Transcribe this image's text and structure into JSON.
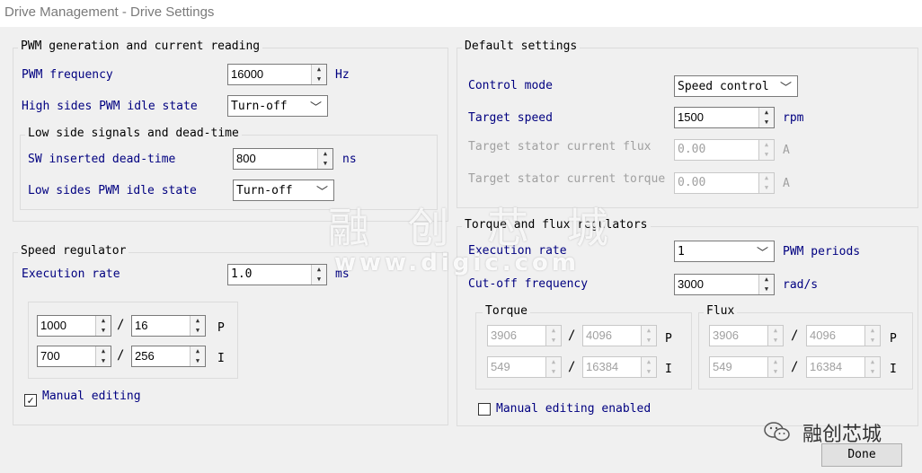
{
  "window": {
    "title": "Drive Management - Drive Settings"
  },
  "pwm_group": {
    "title": "PWM generation and current reading",
    "pwm_frequency": {
      "label": "PWM frequency",
      "value": "16000",
      "unit": "Hz"
    },
    "high_idle": {
      "label": "High sides PWM idle state",
      "value": "Turn-off"
    },
    "low_side": {
      "title": "Low side signals and dead-time",
      "dead_time": {
        "label": "SW inserted dead-time",
        "value": "800",
        "unit": "ns"
      },
      "low_idle": {
        "label": "Low sides PWM idle state",
        "value": "Turn-off"
      }
    }
  },
  "speed_group": {
    "title": "Speed regulator",
    "execution_rate": {
      "label": "Execution rate",
      "value": "1.0",
      "unit": "ms"
    },
    "p": {
      "num": "1000",
      "den": "16",
      "label": "P"
    },
    "i": {
      "num": "700",
      "den": "256",
      "label": "I"
    },
    "slash": "/",
    "manual_editing": {
      "label": "Manual editing",
      "checked": true
    }
  },
  "default_group": {
    "title": "Default settings",
    "control_mode": {
      "label": "Control mode",
      "value": "Speed control"
    },
    "target_speed": {
      "label": "Target speed",
      "value": "1500",
      "unit": "rpm"
    },
    "target_flux": {
      "label": "Target stator current flux",
      "value": "0.00",
      "unit": "A"
    },
    "target_torque": {
      "label": "Target stator current torque",
      "value": "0.00",
      "unit": "A"
    }
  },
  "tf_group": {
    "title": "Torque and flux regulators",
    "execution_rate": {
      "label": "Execution rate",
      "value": "1",
      "unit": "PWM periods"
    },
    "cutoff": {
      "label": "Cut-off frequency",
      "value": "3000",
      "unit": "rad/s"
    },
    "torque": {
      "title": "Torque",
      "p": {
        "num": "3906",
        "den": "4096",
        "label": "P"
      },
      "i": {
        "num": "549",
        "den": "16384",
        "label": "I"
      }
    },
    "flux": {
      "title": "Flux",
      "p": {
        "num": "3906",
        "den": "4096",
        "label": "P"
      },
      "i": {
        "num": "549",
        "den": "16384",
        "label": "I"
      }
    },
    "slash": "/",
    "manual_editing": {
      "label": "Manual editing enabled",
      "checked": false
    }
  },
  "watermark": {
    "cn": "融 创 芯 城",
    "url": "www.digic.com"
  },
  "brand": {
    "name": "融创芯城",
    "icon": "wechat-icon"
  },
  "done_button": {
    "label": "Done"
  }
}
